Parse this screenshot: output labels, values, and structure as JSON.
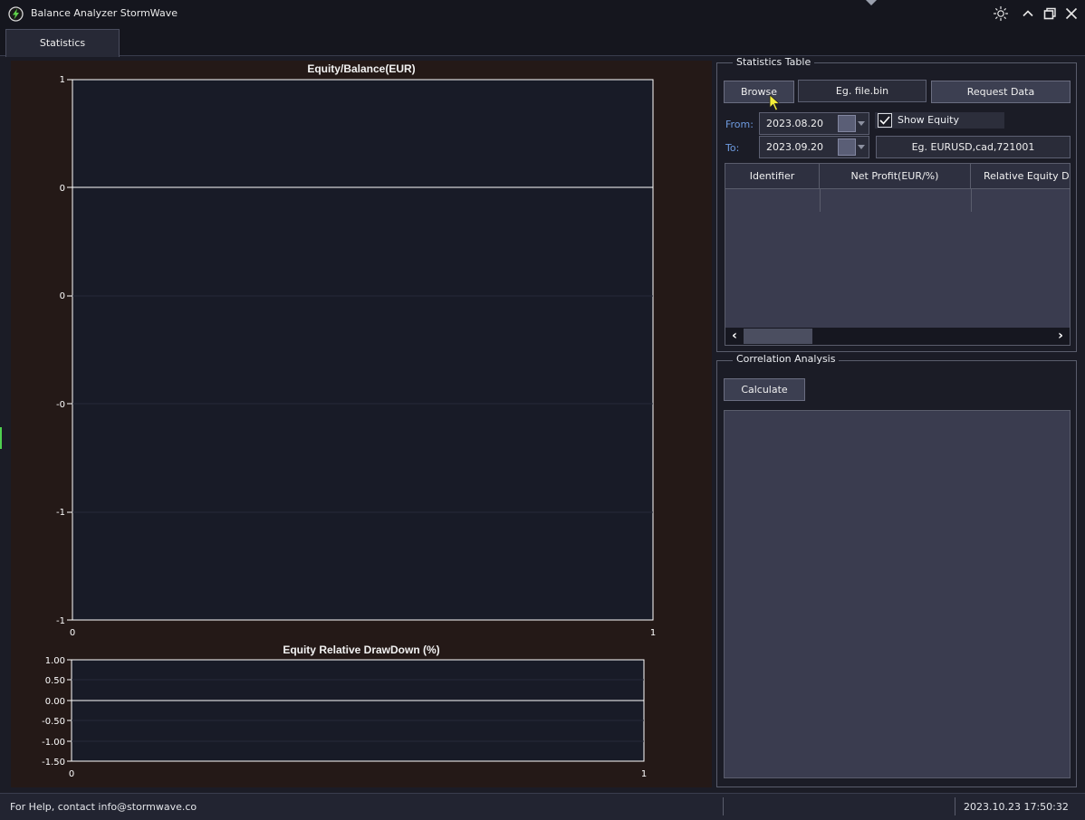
{
  "window": {
    "title": "Balance Analyzer StormWave"
  },
  "tabs": [
    {
      "label": "Statistics"
    }
  ],
  "equity_chart": {
    "title": "Equity/Balance(EUR)",
    "y_ticks": [
      "1",
      "0",
      "0",
      "-0",
      "-1",
      "-1"
    ],
    "x_ticks": [
      "0",
      "1"
    ]
  },
  "drawdown_chart": {
    "title": "Equity Relative DrawDown (%)",
    "y_ticks": [
      "1.00",
      "0.50",
      "0.00",
      "-0.50",
      "-1.00",
      "-1.50"
    ],
    "x_ticks": [
      "0",
      "1"
    ]
  },
  "statistics_table": {
    "group_label": "Statistics Table",
    "browse_label": "Browse",
    "file_placeholder": "Eg. file.bin",
    "request_label": "Request Data",
    "from_label": "From:",
    "from_date": "2023.08.20",
    "to_label": "To:",
    "to_date": "2023.09.20",
    "show_equity_label": "Show Equity",
    "show_equity_checked": true,
    "symbols_placeholder": "Eg. EURUSD,cad,721001",
    "columns": [
      "Identifier",
      "Net Profit(EUR/%)",
      "Relative Equity D"
    ],
    "rows": []
  },
  "correlation": {
    "group_label": "Correlation Analysis",
    "calculate_label": "Calculate"
  },
  "status": {
    "help_text": "For Help, contact info@stormwave.co",
    "datetime": "2023.10.23 17:50:32"
  },
  "colors": {
    "accent_green": "#4fd04f",
    "link_blue": "#6e9be0",
    "chart_background": "#241917",
    "plot_background": "#181b27"
  }
}
